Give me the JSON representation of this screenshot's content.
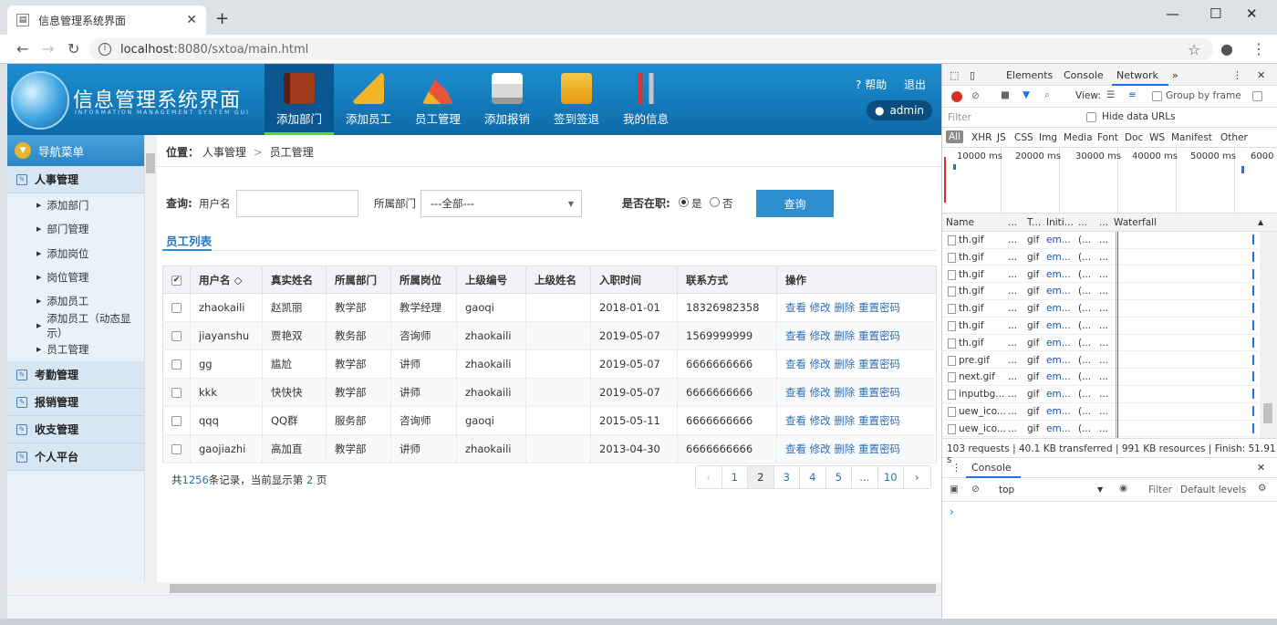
{
  "browser": {
    "tab_title": "信息管理系统界面",
    "new_tab": "+",
    "url_host": "localhost",
    "url_rest": ":8080/sxtoa/main.html"
  },
  "header": {
    "title": "信息管理系统界面",
    "subtitle": "INFORMATION MANAGEMENT SYSTEM GUI",
    "nav": [
      {
        "label": "添加部门",
        "icon": "book-icon",
        "color": "#a03a1c"
      },
      {
        "label": "添加员工",
        "icon": "ruler-icon",
        "color": "#f0b429"
      },
      {
        "label": "员工管理",
        "icon": "tools-icon",
        "color": "#e8563a"
      },
      {
        "label": "添加报销",
        "icon": "printer-icon",
        "color": "#d9d9d9"
      },
      {
        "label": "签到签退",
        "icon": "download-icon",
        "color": "#f2b01e"
      },
      {
        "label": "我的信息",
        "icon": "wrench-icon",
        "color": "#c0c6cc"
      }
    ],
    "help": "帮助",
    "logout": "退出",
    "user": "admin"
  },
  "sidebar": {
    "title": "导航菜单",
    "sections": [
      {
        "label": "人事管理",
        "items": [
          "添加部门",
          "部门管理",
          "添加岗位",
          "岗位管理",
          "添加员工",
          "添加员工（动态显示）",
          "员工管理"
        ]
      },
      {
        "label": "考勤管理",
        "items": []
      },
      {
        "label": "报销管理",
        "items": []
      },
      {
        "label": "收支管理",
        "items": []
      },
      {
        "label": "个人平台",
        "items": []
      }
    ]
  },
  "content": {
    "crumb_prefix": "位置：",
    "crumb_1": "人事管理",
    "crumb_sep": ">",
    "crumb_2": "员工管理",
    "query_label": "查询:",
    "user_label": "用户名",
    "dept_label": "所属部门",
    "dept_value": "---全部---",
    "onjob_label": "是否在职:",
    "yes": "是",
    "no": "否",
    "search_btn": "查询",
    "list_title": "员工列表"
  },
  "table": {
    "headers": [
      "用户名",
      "真实姓名",
      "所属部门",
      "所属岗位",
      "上级编号",
      "上级姓名",
      "入职时间",
      "联系方式",
      "操作"
    ],
    "sort_mark": "◇",
    "rows": [
      [
        "zhaokaili",
        "赵凯丽",
        "教学部",
        "教学经理",
        "gaoqi",
        "",
        "2018-01-01",
        "18326982358"
      ],
      [
        "jiayanshu",
        "贾艳双",
        "教务部",
        "咨询师",
        "zhaokaili",
        "",
        "2019-05-07",
        "1569999999"
      ],
      [
        "gg",
        "尴尬",
        "教学部",
        "讲师",
        "zhaokaili",
        "",
        "2019-05-07",
        "6666666666"
      ],
      [
        "kkk",
        "快快快",
        "教学部",
        "讲师",
        "zhaokaili",
        "",
        "2019-05-07",
        "6666666666"
      ],
      [
        "qqq",
        "QQ群",
        "服务部",
        "咨询师",
        "gaoqi",
        "",
        "2015-05-11",
        "6666666666"
      ],
      [
        "gaojiazhi",
        "高加直",
        "教学部",
        "讲师",
        "zhaokaili",
        "",
        "2013-04-30",
        "6666666666"
      ]
    ],
    "ops": [
      "查看",
      "修改",
      "删除",
      "重置密码"
    ]
  },
  "pagination": {
    "summary_pre": "共",
    "total": "1256",
    "summary_mid": "条记录，当前显示第",
    "current": "2",
    "summary_post": "页",
    "pages": [
      "‹",
      "1",
      "2",
      "3",
      "4",
      "5",
      "...",
      "10",
      "›"
    ]
  },
  "devtools": {
    "tabs": [
      "Elements",
      "Console",
      "Network",
      "»"
    ],
    "view": "View:",
    "group": "Group by frame",
    "filter": "Filter",
    "hide_data": "Hide data URLs",
    "types": [
      "All",
      "XHR",
      "JS",
      "CSS",
      "Img",
      "Media",
      "Font",
      "Doc",
      "WS",
      "Manifest",
      "Other"
    ],
    "timeline": [
      "10000 ms",
      "20000 ms",
      "30000 ms",
      "40000 ms",
      "50000 ms",
      "6000"
    ],
    "columns": [
      "Name",
      "...",
      "T...",
      "Initi...",
      "...",
      "...",
      "Waterfall"
    ],
    "rows": [
      [
        "th.gif",
        "...",
        "gif",
        "em...",
        "(...",
        "..."
      ],
      [
        "th.gif",
        "...",
        "gif",
        "em...",
        "(...",
        "..."
      ],
      [
        "th.gif",
        "...",
        "gif",
        "em...",
        "(...",
        "..."
      ],
      [
        "th.gif",
        "...",
        "gif",
        "em...",
        "(...",
        "..."
      ],
      [
        "th.gif",
        "...",
        "gif",
        "em...",
        "(...",
        "..."
      ],
      [
        "th.gif",
        "...",
        "gif",
        "em...",
        "(...",
        "..."
      ],
      [
        "th.gif",
        "...",
        "gif",
        "em...",
        "(...",
        "..."
      ],
      [
        "pre.gif",
        "...",
        "gif",
        "em...",
        "(...",
        "..."
      ],
      [
        "next.gif",
        "...",
        "gif",
        "em...",
        "(...",
        "..."
      ],
      [
        "inputbg...",
        "...",
        "gif",
        "em...",
        "(...",
        "..."
      ],
      [
        "uew_ico...",
        "...",
        "gif",
        "em...",
        "(...",
        "..."
      ],
      [
        "uew_ico...",
        "...",
        "gif",
        "em...",
        "(...",
        "..."
      ]
    ],
    "status": "103 requests | 40.1 KB transferred | 991 KB resources | Finish: 51.91 s",
    "console_tab": "Console",
    "context": "top",
    "console_filter": "Filter",
    "levels": "Default levels",
    "prompt": "›"
  }
}
